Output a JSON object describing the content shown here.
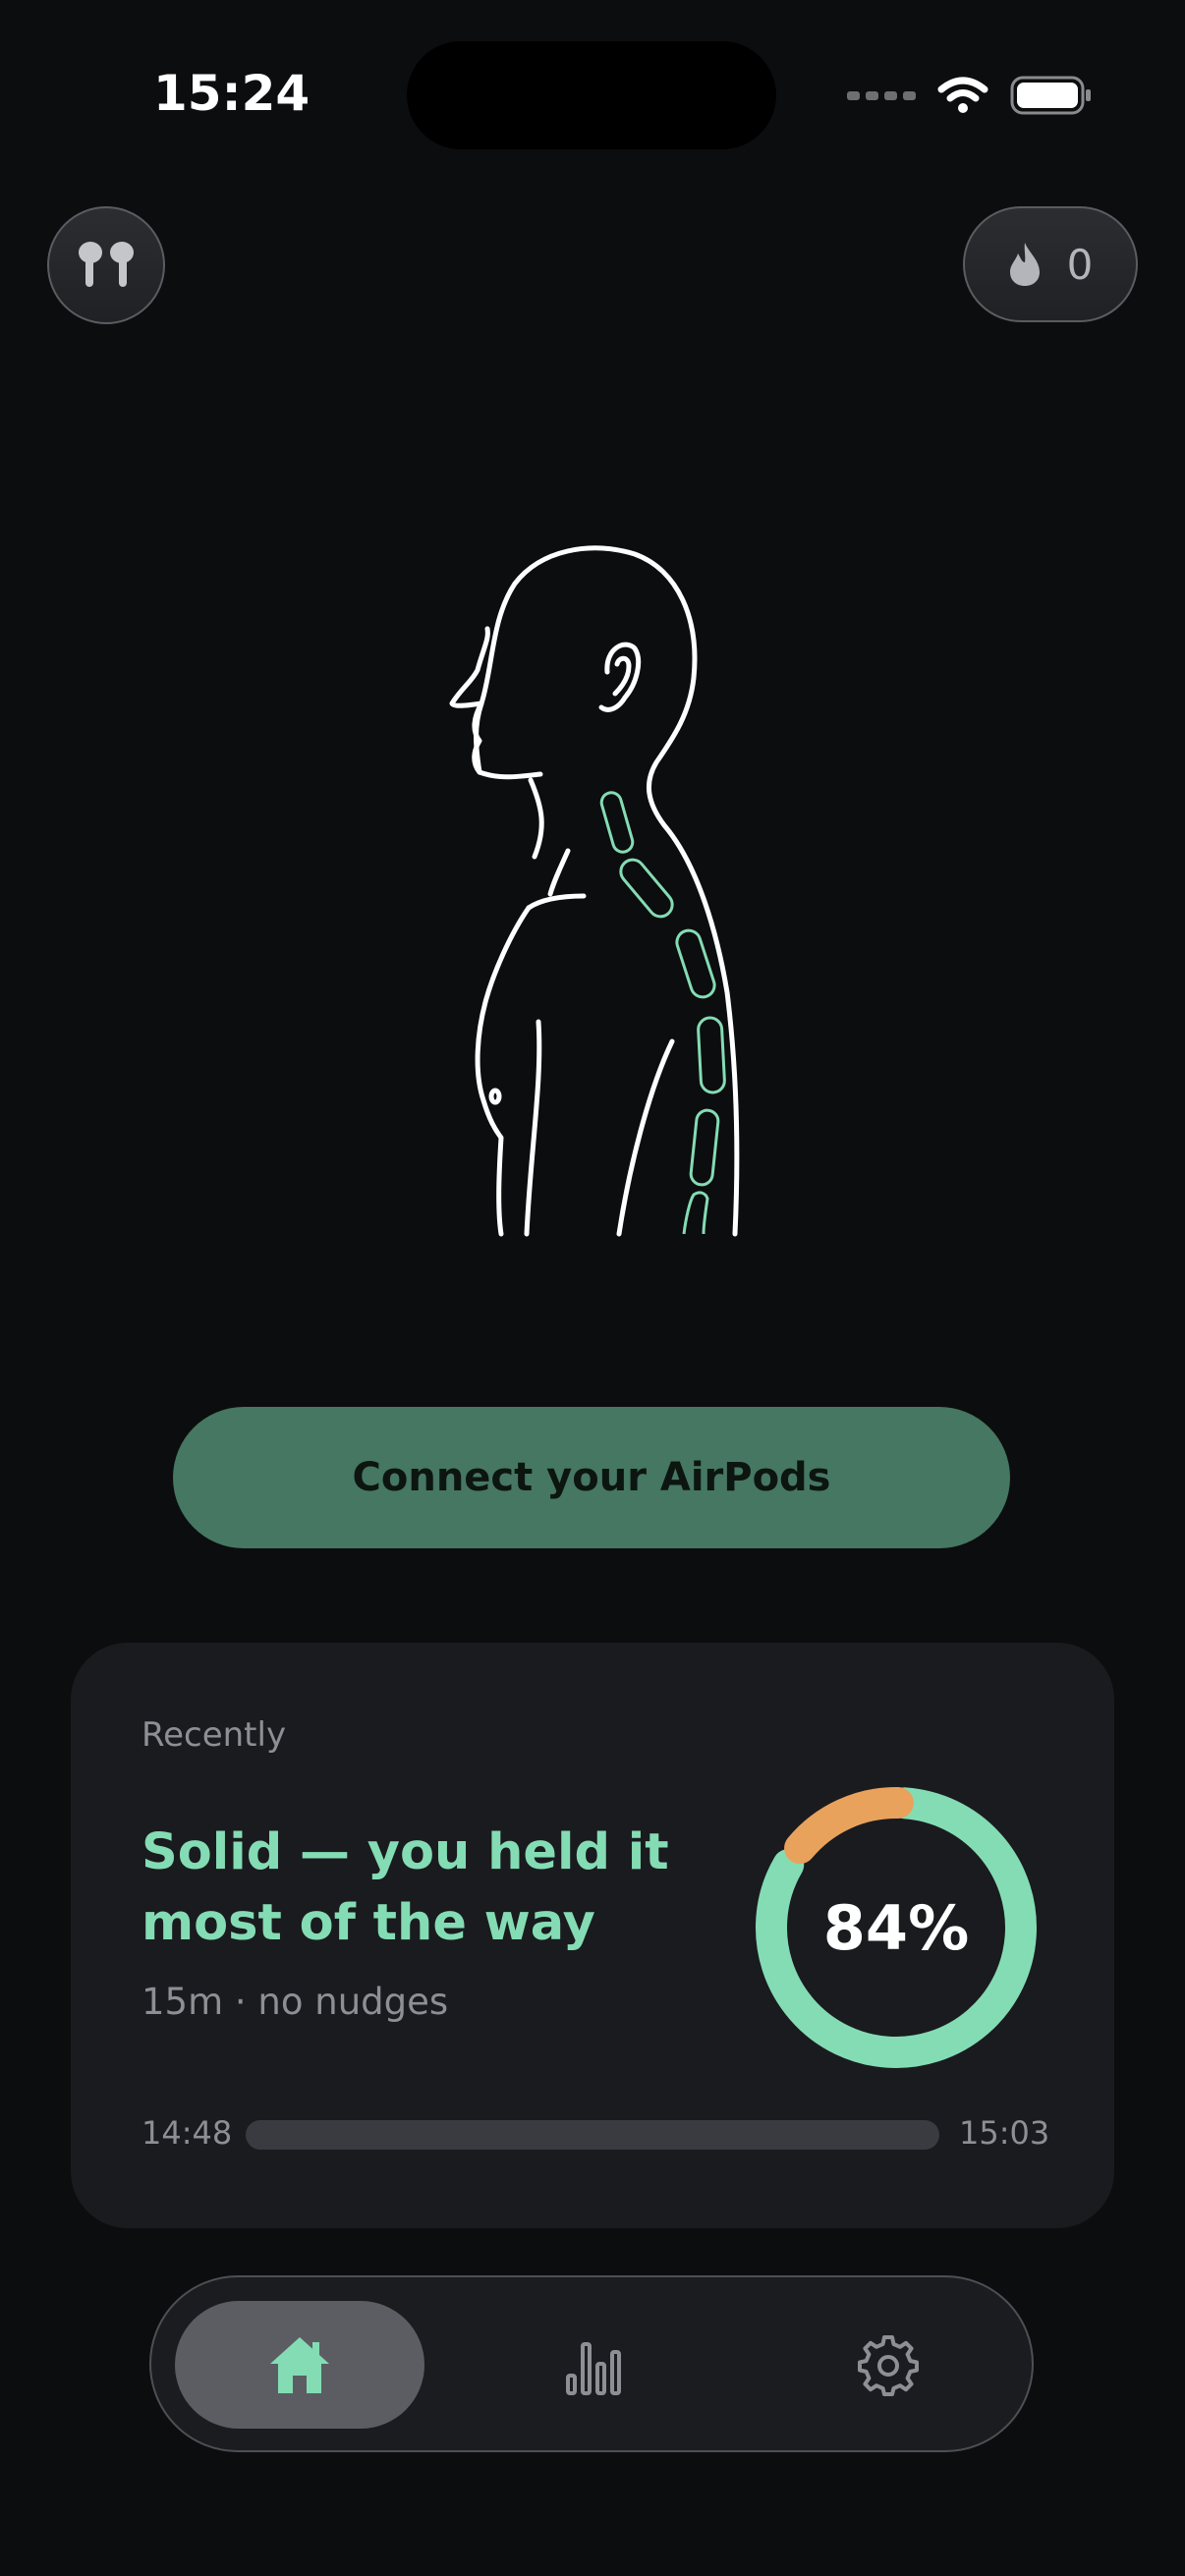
{
  "status_bar": {
    "time": "15:24"
  },
  "header": {
    "streak_count": "0"
  },
  "colors": {
    "accent": "#84dcb4",
    "warning": "#e9a25c",
    "button": "#457762",
    "background": "#0c0d0f",
    "card": "#1a1b1f"
  },
  "icons": {
    "airpods": "airpods-icon",
    "streak": "flame-icon",
    "home": "home-icon",
    "stats": "bar-chart-icon",
    "settings": "gear-icon"
  },
  "main": {
    "connect_label": "Connect your AirPods"
  },
  "recent": {
    "label": "Recently",
    "headline": "Solid — you held it most of the way",
    "subtitle": "15m · no nudges",
    "score": "84%",
    "score_fraction": 0.84,
    "start_time": "14:48",
    "end_time": "15:03"
  },
  "tabbar": {
    "active": "home"
  }
}
